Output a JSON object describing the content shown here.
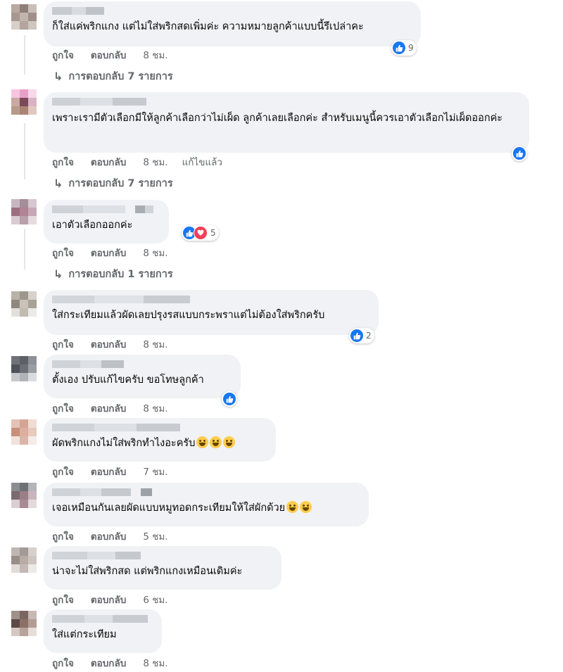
{
  "comments": [
    {
      "text": "ก็ใส่แค่พริกแกง แต่ไม่ใส่พริกสดเพิ่มค่ะ ความหมายลูกค้าแบบนี้รึเปล่าคะ",
      "like": "ถูกใจ",
      "reply": "ตอบกลับ",
      "time": "8 ชม.",
      "edited": "",
      "reaction_count": "9",
      "replies": "การตอบกลับ 7 รายการ"
    },
    {
      "text": "เพราะเรามีตัวเลือกมีให้ลูกค้าเลือกว่าไม่เผ็ด ลูกค้าเลยเลือกค่ะ สำหรับเมนูนี้ควรเอาตัวเลือกไม่เผ็ดออกค่ะ",
      "like": "ถูกใจ",
      "reply": "ตอบกลับ",
      "time": "8 ชม.",
      "edited": "แก้ไขแล้ว",
      "reaction_count": "",
      "replies": "การตอบกลับ 7 รายการ"
    },
    {
      "text": "เอาตัวเลือกออกค่ะ",
      "like": "ถูกใจ",
      "reply": "ตอบกลับ",
      "time": "8 ชม.",
      "edited": "",
      "reaction_count": "5",
      "replies": "การตอบกลับ 1 รายการ"
    },
    {
      "text": "ใส่กระเทียมแล้วผัดเลยปรุงรสแบบกระพราแต่ไม่ต้องใส่พริกครับ",
      "like": "ถูกใจ",
      "reply": "ตอบกลับ",
      "time": "8 ชม.",
      "edited": "",
      "reaction_count": "2",
      "replies": ""
    },
    {
      "text": "ตั้งเอง ปรับแก้ไขครับ ขอโทษลูกค้า",
      "like": "ถูกใจ",
      "reply": "ตอบกลับ",
      "time": "8 ชม.",
      "edited": "",
      "reaction_count": "",
      "replies": ""
    },
    {
      "text": "ผัดพริกแกงไม่ใส่พริกทำไงอะครับ",
      "like": "ถูกใจ",
      "reply": "ตอบกลับ",
      "time": "7 ชม.",
      "edited": "",
      "reaction_count": "",
      "replies": ""
    },
    {
      "text": "เจอเหมือนกันเลยผัดแบบหมูทอดกระเทียมให้ใส่ผักด้วย",
      "like": "ถูกใจ",
      "reply": "ตอบกลับ",
      "time": "5 ชม.",
      "edited": "",
      "reaction_count": "",
      "replies": ""
    },
    {
      "text": "น่าจะไม่ใส่พริกสด แต่พริกแกงเหมือนเดิมค่ะ",
      "like": "ถูกใจ",
      "reply": "ตอบกลับ",
      "time": "6 ชม.",
      "edited": "",
      "reaction_count": "",
      "replies": ""
    },
    {
      "text": "ใส่แต่กระเทียม",
      "like": "ถูกใจ",
      "reply": "ตอบกลับ",
      "time": "8 ชม.",
      "edited": "",
      "reaction_count": "",
      "replies": ""
    }
  ],
  "icons": {
    "like": "like-reaction-icon",
    "love": "love-reaction-icon",
    "reply_arrow": "reply-arrow-icon",
    "emoji": "laughing-emoji-icon"
  },
  "colors": {
    "bubble": "#f0f2f5",
    "meta_text": "#65676b",
    "like_blue": "#1877f2",
    "love_red": "#f33e58"
  }
}
